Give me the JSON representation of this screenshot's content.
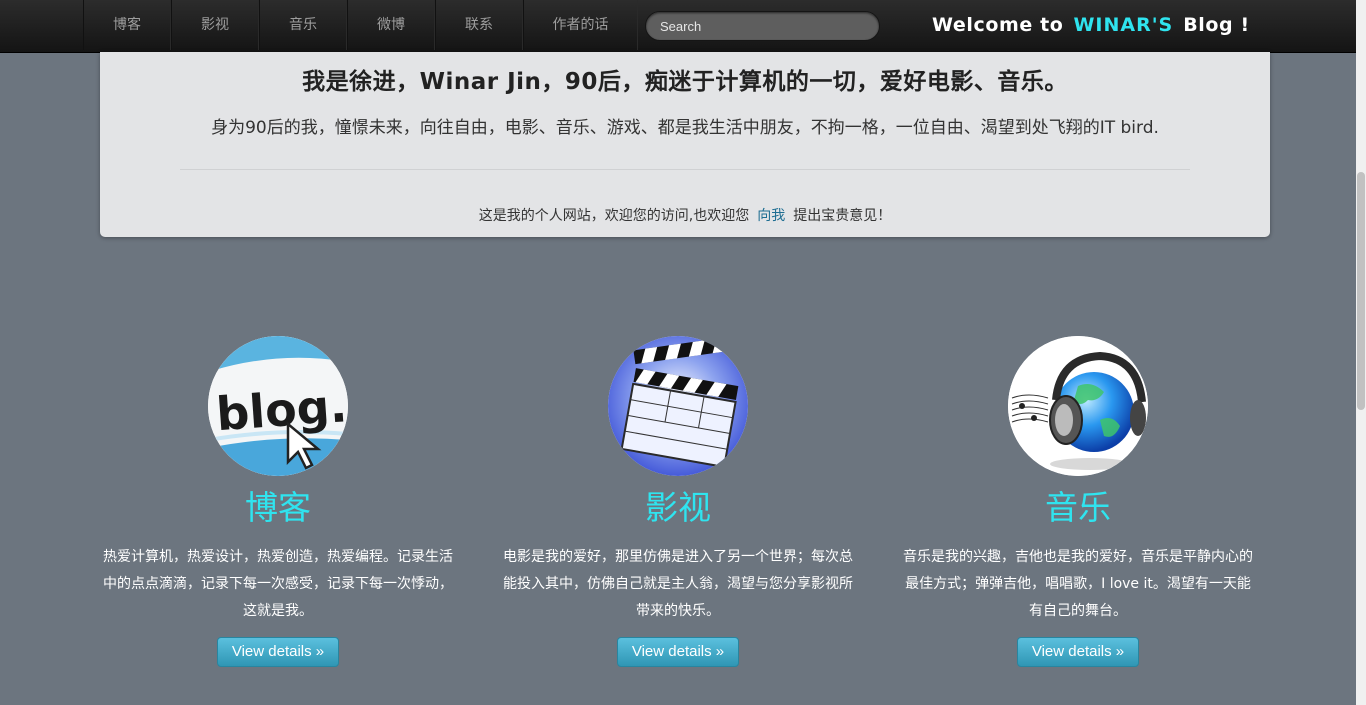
{
  "nav": {
    "items": [
      {
        "label": "博客"
      },
      {
        "label": "影视"
      },
      {
        "label": "音乐"
      },
      {
        "label": "微博"
      },
      {
        "label": "联系"
      },
      {
        "label": "作者的话"
      }
    ],
    "search_placeholder": "Search",
    "brand": {
      "prefix": "Welcome to",
      "accent": "WINAR'S",
      "suffix": "Blog !"
    }
  },
  "hero": {
    "heading": "我是徐进，Winar Jin，90后，痴迷于计算机的一切，爱好电影、音乐。",
    "lead": "身为90后的我，憧憬未来，向往自由，电影、音乐、游戏、都是我生活中朋友，不拘一格，一位自由、渴望到处飞翔的IT bird.",
    "note_before": "这是我的个人网站，欢迎您的访问,也欢迎您",
    "note_link": "向我",
    "note_after": "提出宝贵意见！"
  },
  "features": [
    {
      "title": "博客",
      "image_icon": "blog-image",
      "text": "热爱计算机，热爱设计，热爱创造，热爱编程。记录生活中的点点滴滴，记录下每一次感受，记录下每一次悸动，这就是我。",
      "button": "View details »"
    },
    {
      "title": "影视",
      "image_icon": "clapperboard-image",
      "text": "电影是我的爱好，那里仿佛是进入了另一个世界；每次总能投入其中，仿佛自己就是主人翁，渴望与您分享影视所带来的快乐。",
      "button": "View details »"
    },
    {
      "title": "音乐",
      "image_icon": "headphones-image",
      "text": "音乐是我的兴趣，吉他也是我的爱好，音乐是平静内心的最佳方式；弹弹吉他，唱唱歌，I love it。渴望有一天能有自己的舞台。",
      "button": "View details »"
    }
  ],
  "colors": {
    "accent": "#2fe4ef",
    "background": "#6c757f",
    "button": "#3aa6c8"
  }
}
